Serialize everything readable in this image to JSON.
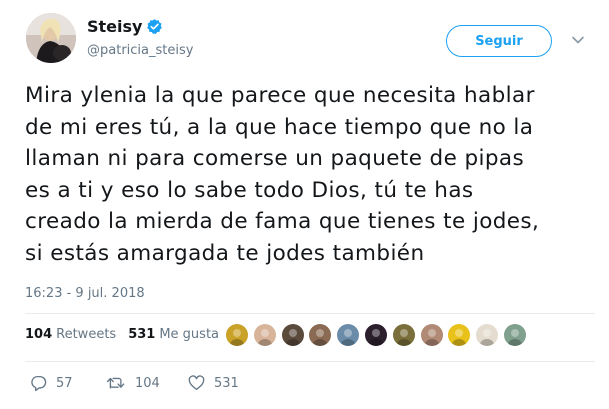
{
  "header": {
    "display_name": "Steisy",
    "handle": "@patricia_steisy",
    "verified": true,
    "follow_label": "Seguir"
  },
  "tweet": {
    "text_lines": [
      "Mira ylenia la que parece que necesita hablar",
      "de mi eres tú, a la que hace tiempo que no la",
      "llaman ni para comerse un paquete de pipas",
      "es a ti y eso lo sabe todo Dios, tú te has",
      "creado la mierda de fama que tienes te jodes,",
      "si estás amargada te jodes también"
    ],
    "timestamp": "16:23 - 9 jul. 2018"
  },
  "stats": {
    "retweets_count": "104",
    "retweets_label": "Retweets",
    "likes_count": "531",
    "likes_label": "Me gusta"
  },
  "likers": [
    {
      "icon": "liker-avatar",
      "color": "#c9a227"
    },
    {
      "icon": "liker-avatar",
      "color": "#d8b49a"
    },
    {
      "icon": "liker-avatar",
      "color": "#5a4a3c"
    },
    {
      "icon": "liker-avatar",
      "color": "#8a6a52"
    },
    {
      "icon": "liker-avatar",
      "color": "#6a8ca8"
    },
    {
      "icon": "liker-avatar",
      "color": "#2b1f2e"
    },
    {
      "icon": "liker-avatar",
      "color": "#7a6e3a"
    },
    {
      "icon": "liker-avatar",
      "color": "#b08a74"
    },
    {
      "icon": "liker-avatar",
      "color": "#e8c21a"
    },
    {
      "icon": "liker-avatar",
      "color": "#e4dccf"
    },
    {
      "icon": "liker-avatar",
      "color": "#7fa08c"
    }
  ],
  "actions": {
    "reply_count": "57",
    "retweet_count": "104",
    "like_count": "531"
  },
  "colors": {
    "accent": "#1da1f2",
    "muted": "#657786",
    "text": "#14171a"
  }
}
